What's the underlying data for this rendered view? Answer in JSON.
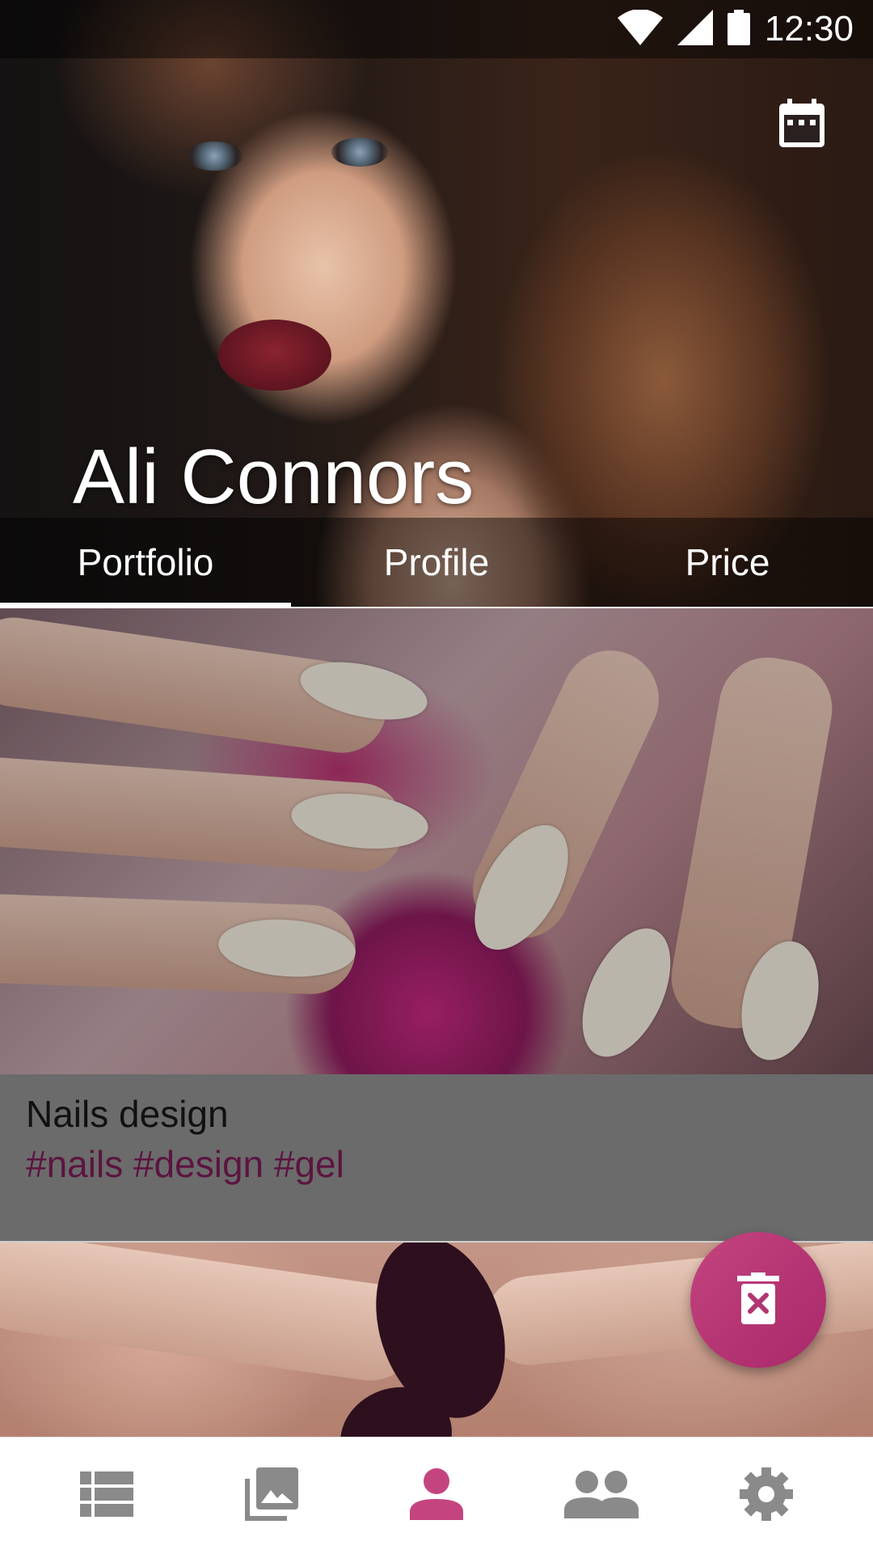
{
  "status_bar": {
    "time": "12:30",
    "icons": [
      "wifi-icon",
      "cell-signal-icon",
      "battery-icon"
    ]
  },
  "header": {
    "name": "Ali Connors",
    "calendar_icon": "calendar-icon"
  },
  "tabs": [
    {
      "label": "Portfolio",
      "selected": true
    },
    {
      "label": "Profile",
      "selected": false
    },
    {
      "label": "Price",
      "selected": false
    }
  ],
  "portfolio": [
    {
      "title": "Nails design",
      "tags": "#nails #design #gel"
    }
  ],
  "fab": {
    "icon": "delete-icon"
  },
  "bottom_nav": [
    {
      "icon": "list-icon",
      "selected": false
    },
    {
      "icon": "gallery-icon",
      "selected": false
    },
    {
      "icon": "person-icon",
      "selected": true
    },
    {
      "icon": "people-icon",
      "selected": false
    },
    {
      "icon": "settings-icon",
      "selected": false
    }
  ],
  "colors": {
    "accent": "#c4447f",
    "tag_color": "#5c1440",
    "nav_inactive": "#8a8a8a",
    "card_info_bg": "#6b6b6b"
  }
}
